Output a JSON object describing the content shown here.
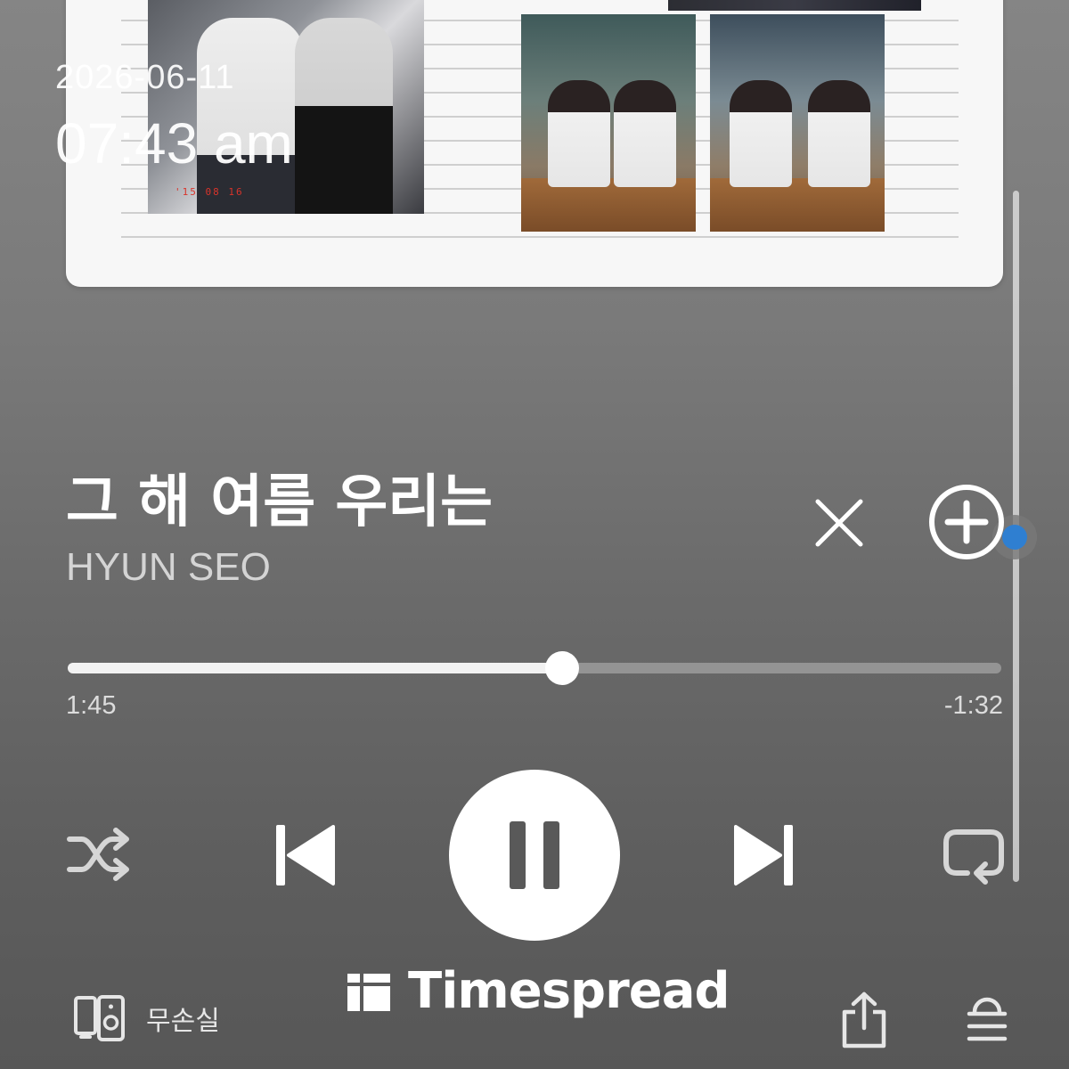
{
  "overlay": {
    "date": "2026-06-11",
    "time": "07:43 am"
  },
  "album_art": {
    "stamp": "'15 08 16"
  },
  "track": {
    "title": "그 해 여름 우리는",
    "artist": "HYUN SEO"
  },
  "progress": {
    "elapsed": "1:45",
    "remaining": "-1:32",
    "fraction": 0.53
  },
  "controls": {
    "shuffle": "shuffle-icon",
    "previous": "skip-previous-icon",
    "play_state": "pause-icon",
    "next": "skip-next-icon",
    "repeat": "repeat-icon"
  },
  "bottom_bar": {
    "device_label": "무손실",
    "watermark": "Timespread"
  },
  "colors": {
    "accent": "#2f7fd1",
    "foreground": "#ffffff"
  }
}
